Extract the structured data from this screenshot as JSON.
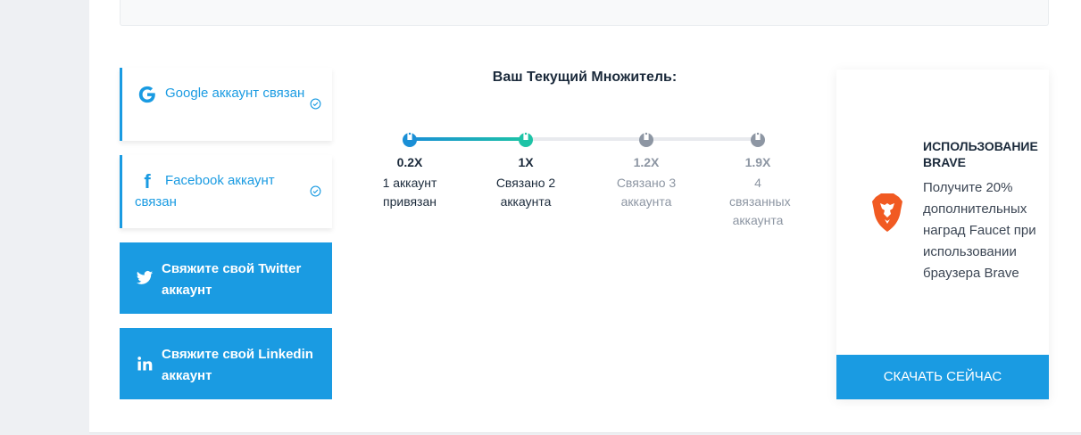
{
  "social": {
    "google": {
      "label": "Google аккаунт связан",
      "icon": "google-icon"
    },
    "facebook": {
      "label": "Facebook аккаунт связан",
      "icon": "facebook-icon"
    },
    "twitter": {
      "label": "Свяжите свой Twitter аккаунт",
      "icon": "twitter-icon"
    },
    "linkedin": {
      "label": "Свяжите свой Linkedin аккаунт",
      "icon": "linkedin-icon"
    }
  },
  "multiplier": {
    "title": "Ваш Текущий Множитель:",
    "steps": [
      {
        "value": "0.2X",
        "desc": "1 аккаунт привязан",
        "active": true
      },
      {
        "value": "1X",
        "desc": "Связано 2 аккаунта",
        "active": true
      },
      {
        "value": "1.2X",
        "desc": "Связано 3 аккаунта",
        "active": false
      },
      {
        "value": "1.9X",
        "desc": "4 связанных аккаунта",
        "active": false
      }
    ]
  },
  "brave": {
    "title": "ИСПОЛЬЗОВАНИЕ BRAVE",
    "text": "Получите 20% дополнительных наград Faucet при использовании браузера Brave",
    "button": "СКАЧАТЬ СЕЙЧАС",
    "icon": "brave-lion-icon"
  },
  "colors": {
    "accent": "#1a9be2",
    "track_active_end": "#1dc3a6",
    "inactive": "#8d96a3"
  }
}
